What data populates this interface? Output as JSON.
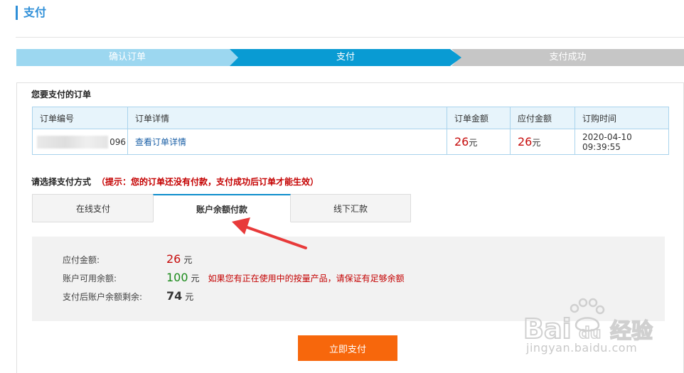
{
  "header": {
    "title": "支付"
  },
  "steps": [
    {
      "label": "确认订单"
    },
    {
      "label": "支付"
    },
    {
      "label": "支付成功"
    }
  ],
  "order": {
    "section_title": "您要支付的订单",
    "columns": [
      "订单编号",
      "订单详情",
      "订单金额",
      "应付金额",
      "订购时间"
    ],
    "row": {
      "order_id_suffix": "096",
      "detail_link": "查看订单详情",
      "amount_value": "26",
      "amount_unit": "元",
      "payable_value": "26",
      "payable_unit": "元",
      "order_time": "2020-04-10 09:39:55"
    }
  },
  "payment": {
    "section_title": "请选择支付方式",
    "hint": "（提示：您的订单还没有付款，支付成功后订单才能生效）",
    "tabs": [
      {
        "label": "在线支付",
        "active": false
      },
      {
        "label": "账户余额付款",
        "active": true
      },
      {
        "label": "线下汇款",
        "active": false
      }
    ],
    "balance": {
      "payable_label": "应付金额:",
      "payable_value": "26",
      "available_label": "账户可用余额:",
      "available_value": "100",
      "remain_label": "支付后账户余额剩余:",
      "remain_value": "74",
      "unit": "元",
      "warning": "如果您有正在使用中的按量产品，请保证有足够余额"
    },
    "pay_button": "立即支付"
  },
  "watermark": {
    "text": "Bai 经验",
    "sub": "jingyan.baidu.com"
  },
  "colors": {
    "accent": "#099bd3",
    "step_done": "#9cd7f0",
    "step_todo": "#c6c6c6",
    "money_red": "#c60d0d",
    "balance_green": "#1a8a1a",
    "button_orange": "#f7670c",
    "hint_red": "#c40000",
    "arrow_red": "#e83a3a"
  }
}
